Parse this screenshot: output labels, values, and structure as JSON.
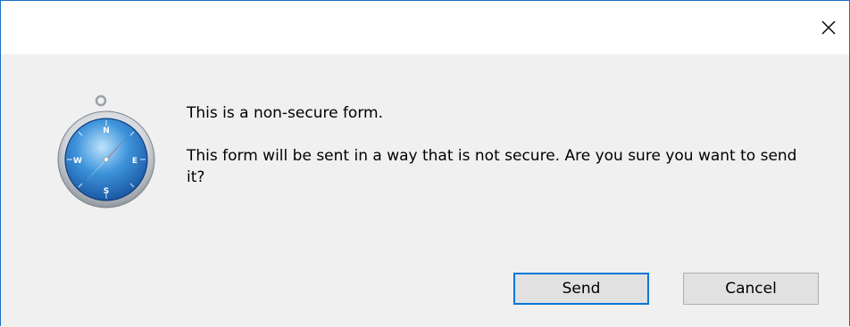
{
  "dialog": {
    "title": "This is a non-secure form.",
    "message": "This form will be sent in a way that is not secure. Are you sure you want to send it?",
    "icon": "safari-compass-icon",
    "close_glyph": "close-icon"
  },
  "buttons": {
    "send_label": "Send",
    "cancel_label": "Cancel"
  },
  "colors": {
    "accent": "#0078d7",
    "window_border": "#1a73c6",
    "dialog_background": "#f0f0f0",
    "button_background": "#e1e1e1"
  }
}
